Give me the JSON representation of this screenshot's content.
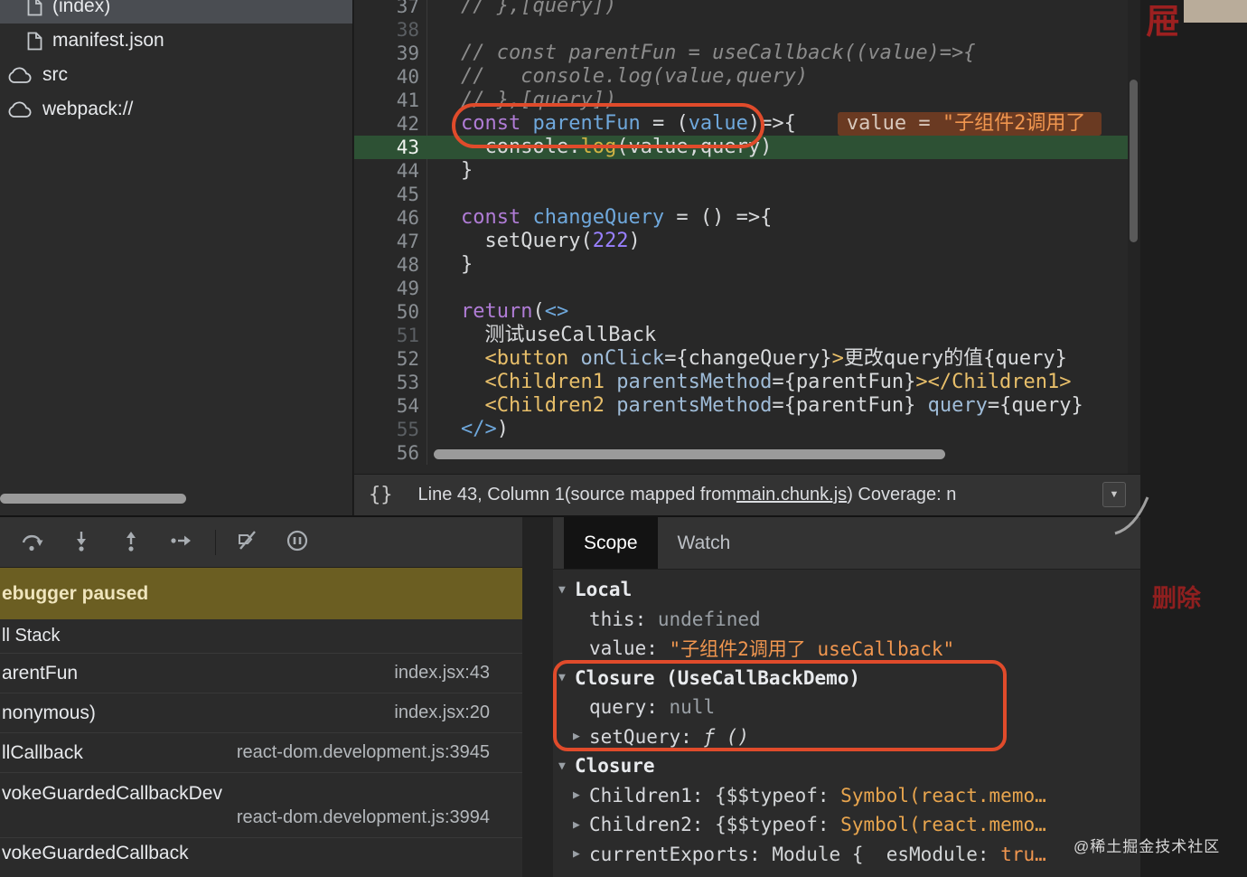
{
  "colors": {
    "annotation-red": "#e04b2b",
    "exec-green": "#2d5134",
    "banner-olive": "#6b5e22",
    "string-orange": "#f0964f",
    "keyword-purple": "#b07cd6",
    "function-blue": "#6fa8dc",
    "tag-gold": "#e8bf6a",
    "selected-row": "#4a4d52"
  },
  "filetree": {
    "items": [
      {
        "label": "(index)",
        "icon": "file",
        "selected": true,
        "indent": true
      },
      {
        "label": "manifest.json",
        "icon": "file",
        "indent": true
      },
      {
        "label": "src",
        "icon": "cloud"
      },
      {
        "label": "webpack://",
        "icon": "cloud"
      }
    ]
  },
  "editor": {
    "lines": [
      {
        "num": "37",
        "tokens": [
          {
            "c": "com",
            "t": "// },[query])"
          }
        ]
      },
      {
        "num": "38",
        "dim": true,
        "tokens": []
      },
      {
        "num": "39",
        "tokens": [
          {
            "c": "com",
            "t": "// const parentFun = useCallback((value)=>{"
          }
        ]
      },
      {
        "num": "40",
        "tokens": [
          {
            "c": "com",
            "t": "//   console.log(value,query)"
          }
        ]
      },
      {
        "num": "41",
        "tokens": [
          {
            "c": "com",
            "t": "// },[query])"
          }
        ]
      },
      {
        "num": "42",
        "tokens": [
          {
            "c": "kw",
            "t": "const "
          },
          {
            "c": "fn",
            "t": "parentFun"
          },
          {
            "c": "pl",
            "t": " = ("
          },
          {
            "c": "fn",
            "t": "value"
          },
          {
            "c": "pl",
            "t": ")=>{"
          }
        ],
        "hint": {
          "label": "value = ",
          "str": "\"子组件2调用了"
        }
      },
      {
        "num": "43",
        "exec": true,
        "tokens": [
          {
            "c": "pl",
            "t": "  console."
          },
          {
            "c": "meth",
            "t": "log"
          },
          {
            "c": "pl",
            "t": "(value,query)"
          }
        ]
      },
      {
        "num": "44",
        "tokens": [
          {
            "c": "pl",
            "t": "}"
          }
        ]
      },
      {
        "num": "45",
        "tokens": []
      },
      {
        "num": "46",
        "tokens": [
          {
            "c": "kw",
            "t": "const "
          },
          {
            "c": "fn",
            "t": "changeQuery"
          },
          {
            "c": "pl",
            "t": " = () =>{"
          }
        ]
      },
      {
        "num": "47",
        "tokens": [
          {
            "c": "pl",
            "t": "  setQuery("
          },
          {
            "c": "num",
            "t": "222"
          },
          {
            "c": "pl",
            "t": ")"
          }
        ]
      },
      {
        "num": "48",
        "tokens": [
          {
            "c": "pl",
            "t": "}"
          }
        ]
      },
      {
        "num": "49",
        "tokens": []
      },
      {
        "num": "50",
        "tokens": [
          {
            "c": "kw",
            "t": "return"
          },
          {
            "c": "pl",
            "t": "("
          },
          {
            "c": "tagb",
            "t": "<>"
          }
        ]
      },
      {
        "num": "51",
        "dim": true,
        "tokens": [
          {
            "c": "pl",
            "t": "  测试useCallBack"
          }
        ]
      },
      {
        "num": "52",
        "tokens": [
          {
            "c": "pl",
            "t": "  "
          },
          {
            "c": "tag",
            "t": "<button"
          },
          {
            "c": "attr",
            "t": " onClick"
          },
          {
            "c": "pl",
            "t": "={changeQuery}"
          },
          {
            "c": "tag",
            "t": ">"
          },
          {
            "c": "pl",
            "t": "更改query的值{query}"
          }
        ]
      },
      {
        "num": "53",
        "tokens": [
          {
            "c": "pl",
            "t": "  "
          },
          {
            "c": "tag",
            "t": "<Children1"
          },
          {
            "c": "attr",
            "t": " parentsMethod"
          },
          {
            "c": "pl",
            "t": "={parentFun}"
          },
          {
            "c": "tag",
            "t": "></Children1>"
          }
        ]
      },
      {
        "num": "54",
        "tokens": [
          {
            "c": "pl",
            "t": "  "
          },
          {
            "c": "tag",
            "t": "<Children2"
          },
          {
            "c": "attr",
            "t": " parentsMethod"
          },
          {
            "c": "pl",
            "t": "={parentFun}"
          },
          {
            "c": "attr",
            "t": " query"
          },
          {
            "c": "pl",
            "t": "={query}"
          }
        ]
      },
      {
        "num": "55",
        "dim": true,
        "tokens": [
          {
            "c": "tagb",
            "t": "</>"
          },
          {
            "c": "pl",
            "t": ")"
          }
        ]
      },
      {
        "num": "56",
        "tokens": []
      }
    ]
  },
  "statusbar": {
    "pretty": "{}",
    "position": "Line 43, Column 1",
    "mapped_prefix": " (source mapped from ",
    "mapped_link": "main.chunk.js",
    "suffix": ") Coverage: n",
    "caret": "▼"
  },
  "toolbar": {
    "icons": [
      "step-over",
      "step-into",
      "step-out",
      "step",
      "separator",
      "deactivate-breakpoints",
      "pause-on-exceptions"
    ]
  },
  "banner": {
    "text": "ebugger paused"
  },
  "callstack": {
    "header": "ll Stack",
    "frames": [
      {
        "title": "arentFun",
        "loc": "index.jsx:43"
      },
      {
        "title": "nonymous)",
        "loc": "index.jsx:20"
      },
      {
        "title": "llCallback",
        "loc": "react-dom.development.js:3945"
      },
      {
        "title": "vokeGuardedCallbackDev",
        "loc": "react-dom.development.js:3994",
        "twoline": true
      },
      {
        "title": "vokeGuardedCallback",
        "loc": "",
        "partial": true
      }
    ]
  },
  "scope": {
    "tabs": [
      {
        "label": "Scope",
        "active": true
      },
      {
        "label": "Watch"
      }
    ],
    "rows": [
      {
        "kind": "section",
        "arrow": "▼",
        "label": "Local"
      },
      {
        "kind": "prop",
        "name": "this",
        "values": [
          {
            "c": "dim",
            "t": "undefined"
          }
        ]
      },
      {
        "kind": "prop",
        "name": "value",
        "values": [
          {
            "c": "str",
            "t": "\"子组件2调用了 useCallback\""
          }
        ]
      },
      {
        "kind": "section",
        "arrow": "▼",
        "label": "Closure (UseCallBackDemo)"
      },
      {
        "kind": "prop",
        "name": "query",
        "values": [
          {
            "c": "dim",
            "t": "null"
          }
        ]
      },
      {
        "kind": "prop",
        "arrow": "▶",
        "name": "setQuery",
        "values": [
          {
            "c": "fn",
            "t": "ƒ ()"
          }
        ]
      },
      {
        "kind": "section",
        "arrow": "▼",
        "label": "Closure"
      },
      {
        "kind": "prop",
        "arrow": "▶",
        "name": "Children1",
        "values": [
          {
            "c": "pl",
            "t": "{$$typeof: "
          },
          {
            "c": "sym",
            "t": "Symbol(react.memo…"
          }
        ]
      },
      {
        "kind": "prop",
        "arrow": "▶",
        "name": "Children2",
        "values": [
          {
            "c": "pl",
            "t": "{$$typeof: "
          },
          {
            "c": "sym",
            "t": "Symbol(react.memo…"
          }
        ]
      },
      {
        "kind": "prop",
        "arrow": "▶",
        "name": "currentExports",
        "values": [
          {
            "c": "pl",
            "t": "Module {  esModule: "
          },
          {
            "c": "str",
            "t": "tru…"
          }
        ]
      }
    ]
  },
  "overlays": {
    "top_right_char": "屉",
    "delete_label": "删除",
    "watermark": "@稀土掘金技术社区"
  }
}
